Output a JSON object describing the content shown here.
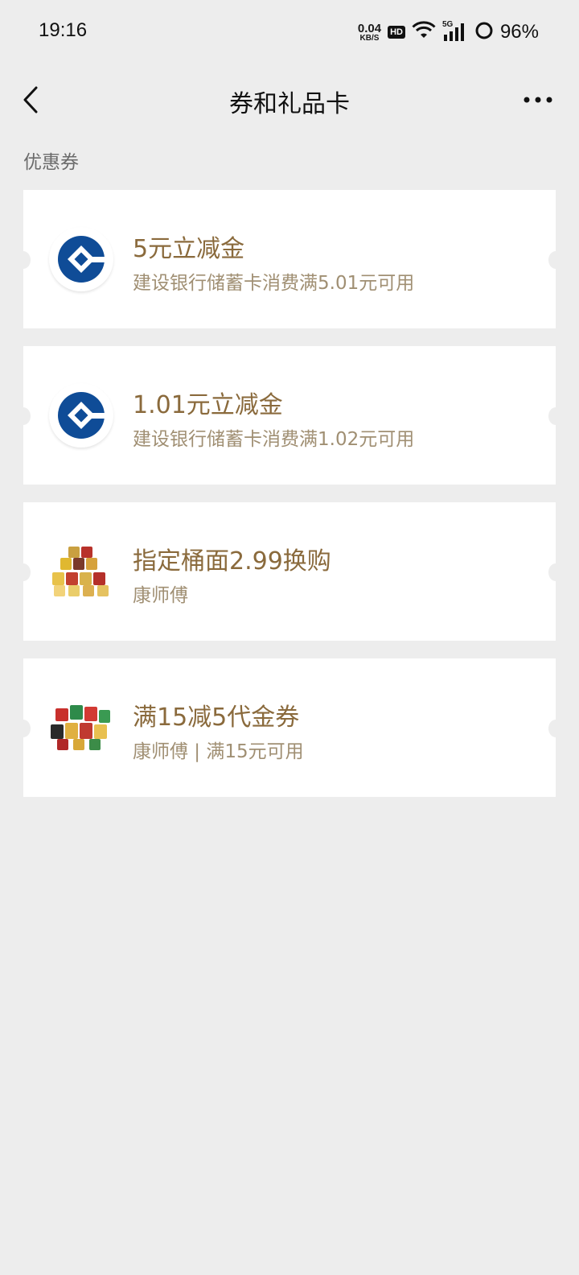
{
  "status_bar": {
    "time": "19:16",
    "net_speed_value": "0.04",
    "net_speed_unit": "KB/S",
    "hd_label": "HD",
    "signal_label": "5G",
    "battery": "96%",
    "icons": [
      "hd-icon",
      "wifi-icon",
      "cellular-signal-icon",
      "battery-icon"
    ]
  },
  "header": {
    "title": "券和礼品卡",
    "back_icon": "chevron-left-icon",
    "more_icon": "more-dots-icon"
  },
  "section": {
    "title": "优惠券"
  },
  "coupons": [
    {
      "title": "5元立减金",
      "desc": "建设银行储蓄卡消费满5.01元可用",
      "logo": "ccb-bank-logo-icon"
    },
    {
      "title": "1.01元立减金",
      "desc": "建设银行储蓄卡消费满1.02元可用",
      "logo": "ccb-bank-logo-icon"
    },
    {
      "title": "指定桶面2.99换购",
      "desc": "康师傅",
      "logo": "instant-noodle-cups-icon"
    },
    {
      "title": "满15减5代金券",
      "desc": "康师傅 | 满15元可用",
      "logo": "instant-noodle-cups-icon"
    }
  ],
  "colors": {
    "background": "#ededed",
    "card": "#ffffff",
    "coupon_title": "#8a6a3c",
    "coupon_desc": "#a08f73",
    "bank_blue": "#0f4c97"
  }
}
